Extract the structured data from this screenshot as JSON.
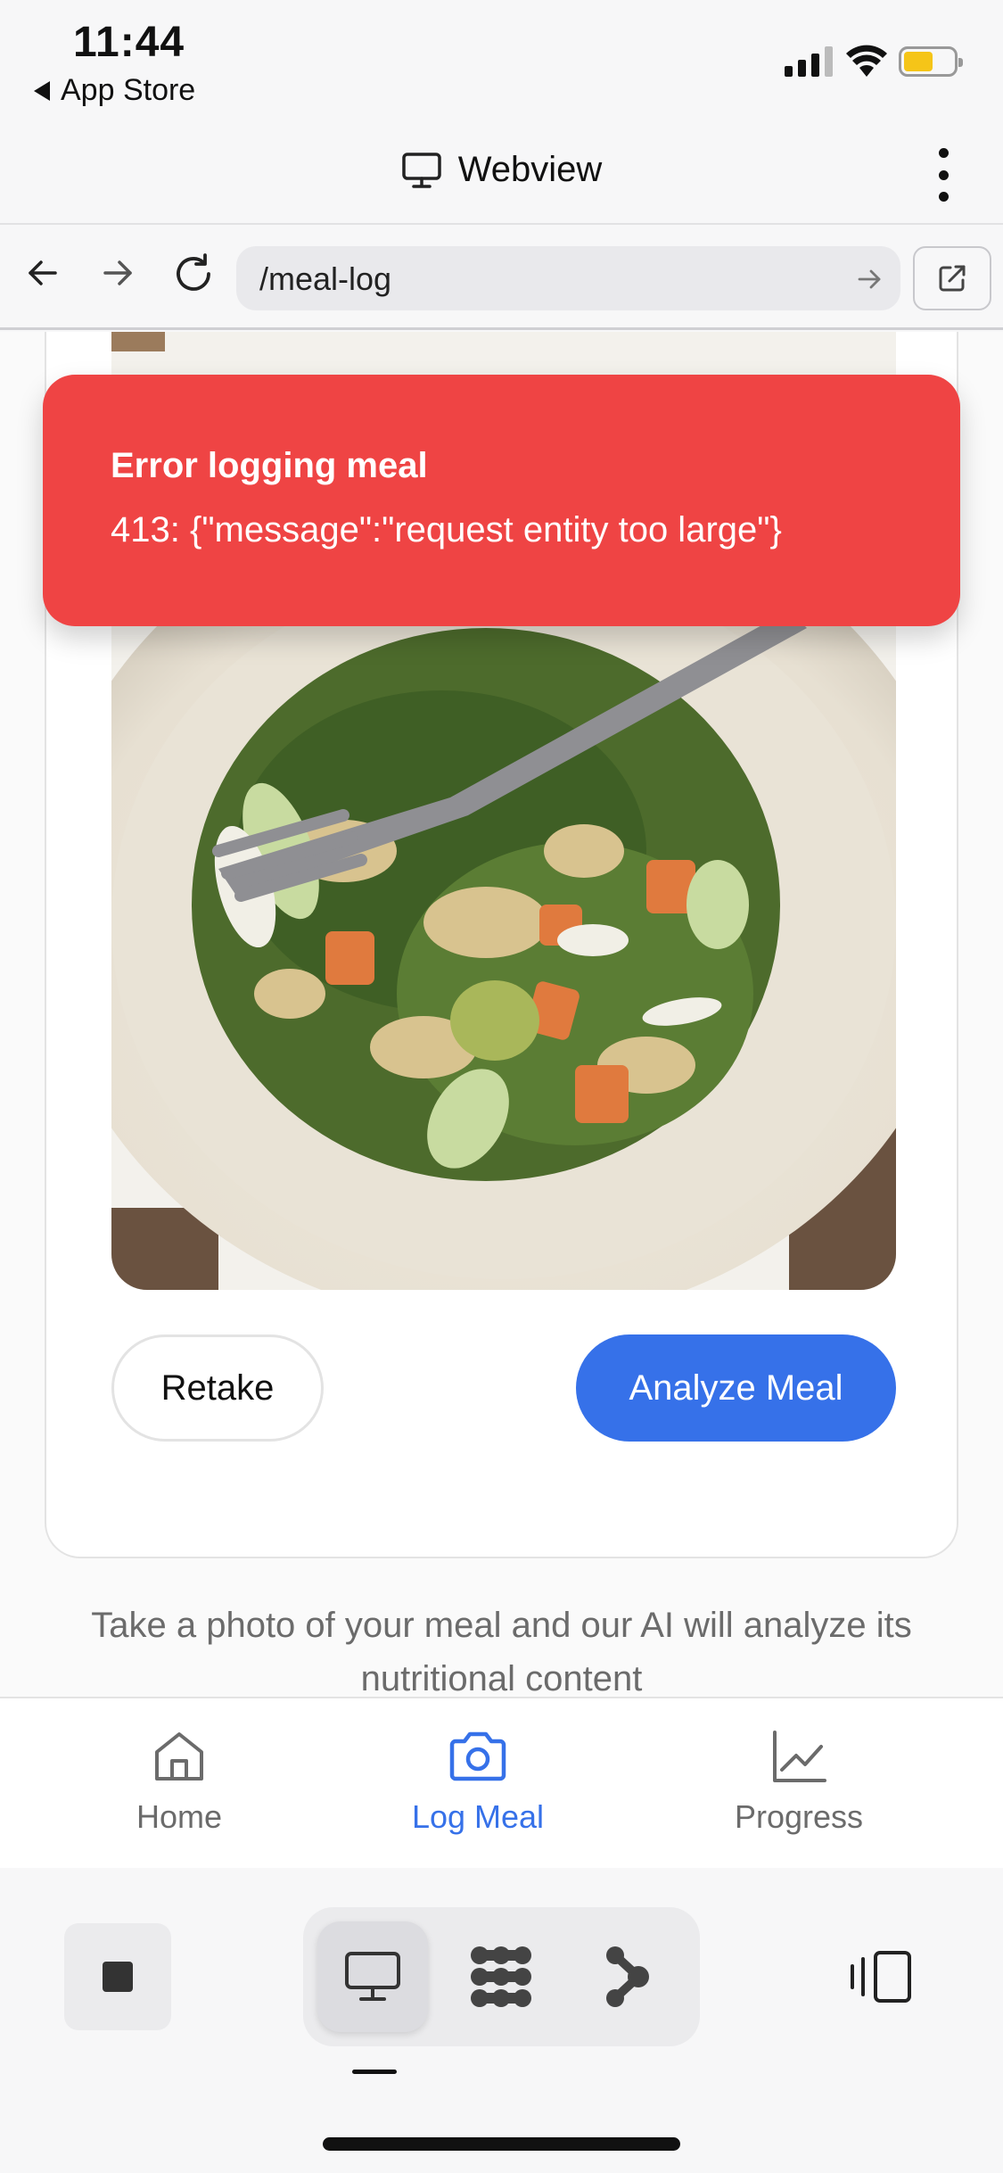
{
  "status_bar": {
    "time": "11:44",
    "back_label": "App Store",
    "battery_color": "#f5c518"
  },
  "webview": {
    "title": "Webview",
    "title_icon": "monitor-icon",
    "menu_icon": "more-vertical-icon"
  },
  "url_bar": {
    "url": "/meal-log",
    "back_icon": "arrow-left-icon",
    "forward_icon": "arrow-right-icon",
    "reload_icon": "reload-icon",
    "go_icon": "arrow-right-icon",
    "external_icon": "external-link-icon"
  },
  "toast": {
    "title": "Error logging meal",
    "message": "413: {\"message\":\"request entity too large\"}",
    "color": "#ef4444"
  },
  "meal_card": {
    "retake_label": "Retake",
    "analyze_label": "Analyze Meal",
    "accent": "#3671e9"
  },
  "helper_text": "Take a photo of your meal and our AI will analyze its nutritional content",
  "tabs": [
    {
      "label": "Home",
      "icon": "home-icon",
      "active": false
    },
    {
      "label": "Log Meal",
      "icon": "camera-icon",
      "active": true
    },
    {
      "label": "Progress",
      "icon": "line-chart-icon",
      "active": false
    }
  ],
  "toolbar": {
    "stop_icon": "stop-icon",
    "modes": [
      "monitor-icon",
      "dots-grid-icon",
      "graph-nodes-icon"
    ],
    "selected_mode": "monitor-icon",
    "panel_icon": "side-panel-icon"
  }
}
